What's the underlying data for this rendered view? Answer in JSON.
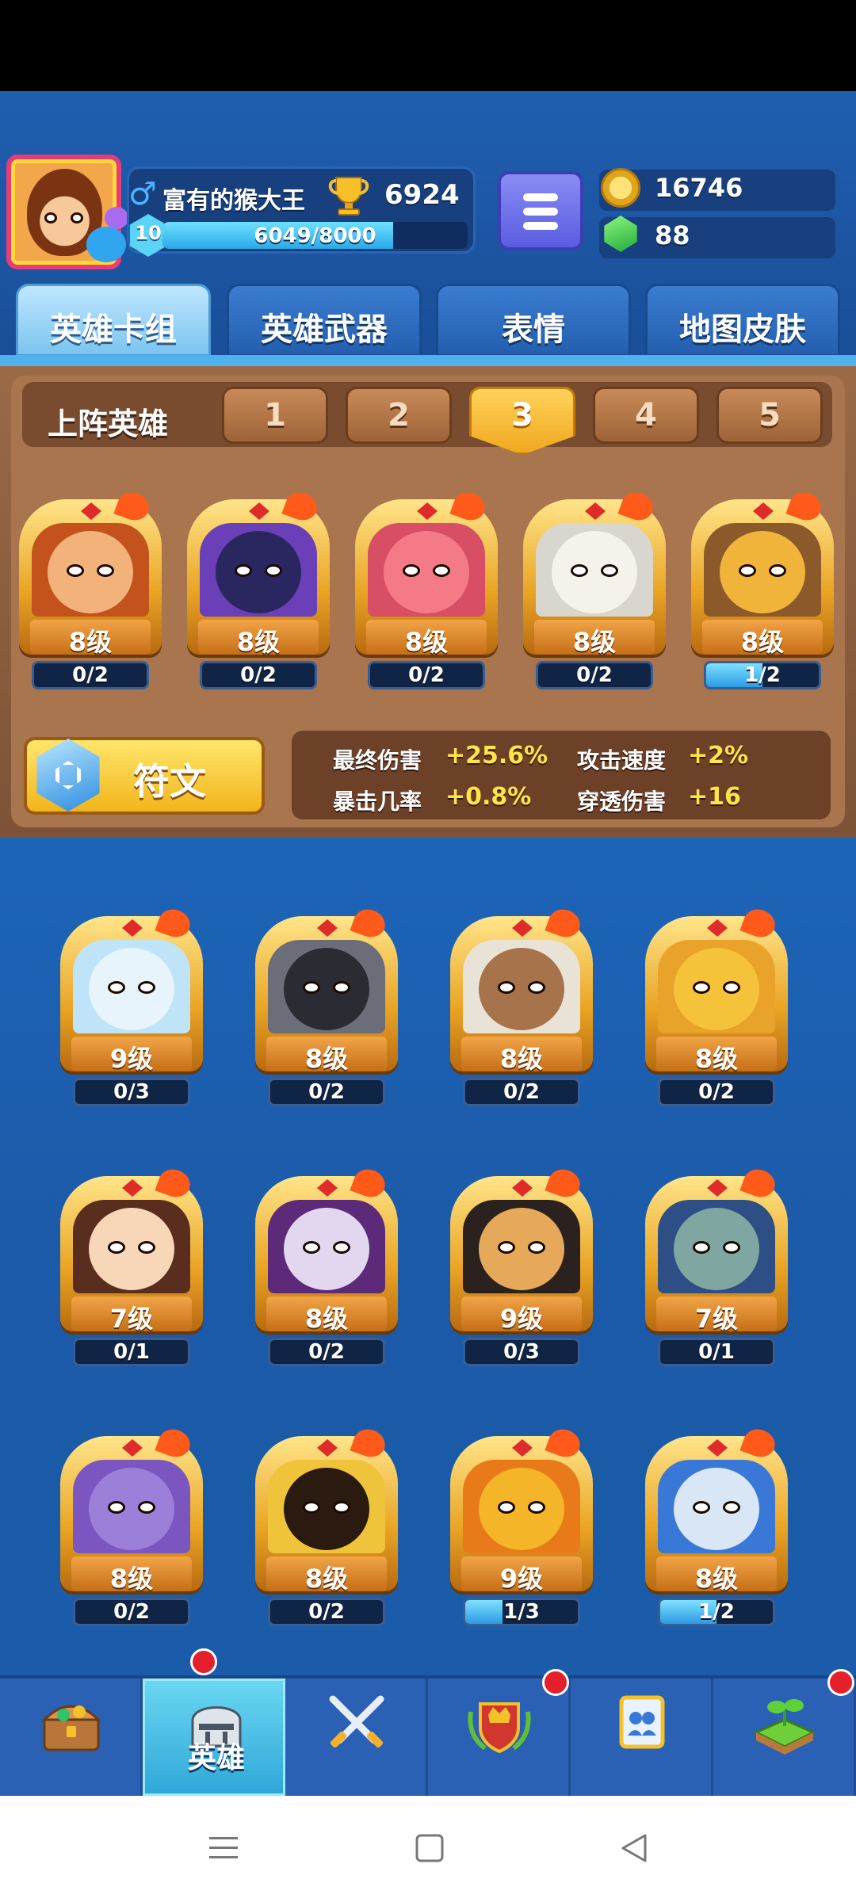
{
  "player": {
    "gender_symbol": "♂",
    "name": "富有的猴大王",
    "trophies": "6924",
    "level": "10",
    "xp": "6049/8000",
    "xp_fraction": 0.756
  },
  "currency": {
    "coins": "16746",
    "gems": "88"
  },
  "tabs": [
    {
      "label": "英雄卡组",
      "active": true
    },
    {
      "label": "英雄武器",
      "active": false
    },
    {
      "label": "表情",
      "active": false
    },
    {
      "label": "地图皮肤",
      "active": false
    }
  ],
  "deck": {
    "title": "上阵英雄",
    "slots": [
      "1",
      "2",
      "3",
      "4",
      "5"
    ],
    "active_slot": "3",
    "heroes": [
      {
        "level": "8级",
        "progress": "0/2",
        "fill": 0,
        "color": "#c3521c",
        "face": "#f3b27a"
      },
      {
        "level": "8级",
        "progress": "0/2",
        "fill": 0,
        "color": "#6a3fb8",
        "face": "#2a2760"
      },
      {
        "level": "8级",
        "progress": "0/2",
        "fill": 0,
        "color": "#d84e64",
        "face": "#f37a86"
      },
      {
        "level": "8级",
        "progress": "0/2",
        "fill": 0,
        "color": "#d9d6cf",
        "face": "#f4f2ea"
      },
      {
        "level": "8级",
        "progress": "1/2",
        "fill": 0.5,
        "color": "#8c5a2a",
        "face": "#f0b43a"
      }
    ]
  },
  "rune": {
    "label": "符文"
  },
  "stats": [
    {
      "label": "最终伤害",
      "value": "+25.6%"
    },
    {
      "label": "攻击速度",
      "value": "+2%"
    },
    {
      "label": "暴击几率",
      "value": "+0.8%"
    },
    {
      "label": "穿透伤害",
      "value": "+16"
    }
  ],
  "collection": [
    {
      "level": "9级",
      "progress": "0/3",
      "fill": 0,
      "color": "#bfe3f7",
      "face": "#e7f4fb"
    },
    {
      "level": "8级",
      "progress": "0/2",
      "fill": 0,
      "color": "#6b6e78",
      "face": "#2a2b33"
    },
    {
      "level": "8级",
      "progress": "0/2",
      "fill": 0,
      "color": "#e9e2d6",
      "face": "#a7734a"
    },
    {
      "level": "8级",
      "progress": "0/2",
      "fill": 0,
      "color": "#e9a32a",
      "face": "#f5c33a"
    },
    {
      "level": "7级",
      "progress": "0/1",
      "fill": 0,
      "color": "#5a2e1e",
      "face": "#f8d6b8"
    },
    {
      "level": "8级",
      "progress": "0/2",
      "fill": 0,
      "color": "#5d2a7a",
      "face": "#e3d7f0"
    },
    {
      "level": "9级",
      "progress": "0/3",
      "fill": 0,
      "color": "#2b2220",
      "face": "#e6a95a"
    },
    {
      "level": "7级",
      "progress": "0/1",
      "fill": 0,
      "color": "#2d4f86",
      "face": "#7fa6a0"
    },
    {
      "level": "8级",
      "progress": "0/2",
      "fill": 0,
      "color": "#7b56c0",
      "face": "#9c7fd8"
    },
    {
      "level": "8级",
      "progress": "0/2",
      "fill": 0,
      "color": "#f0c43a",
      "face": "#2a1a10"
    },
    {
      "level": "9级",
      "progress": "1/3",
      "fill": 0.333,
      "color": "#e87a1a",
      "face": "#f5b528"
    },
    {
      "level": "8级",
      "progress": "1/2",
      "fill": 0.5,
      "color": "#3a78d8",
      "face": "#d8e6f5"
    }
  ],
  "bottom_nav": [
    {
      "icon": "treasure-chest-icon",
      "label": "",
      "active": false,
      "badge": false
    },
    {
      "icon": "knight-helmet-icon",
      "label": "英雄",
      "active": true,
      "badge": true
    },
    {
      "icon": "crossed-swords-icon",
      "label": "",
      "active": false,
      "badge": false
    },
    {
      "icon": "crown-shield-icon",
      "label": "",
      "active": false,
      "badge": true
    },
    {
      "icon": "guild-flag-icon",
      "label": "",
      "active": false,
      "badge": false
    },
    {
      "icon": "sprout-island-icon",
      "label": "",
      "active": false,
      "badge": true
    }
  ],
  "system_nav": [
    "menu-icon",
    "home-icon",
    "back-icon"
  ]
}
